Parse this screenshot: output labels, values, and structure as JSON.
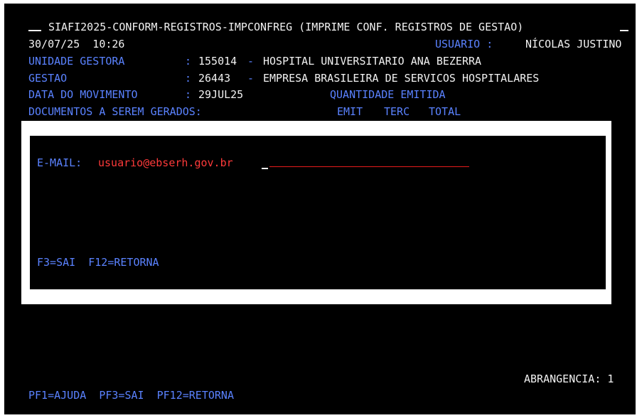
{
  "header": {
    "title": "SIAFI2025-CONFORM-REGISTROS-IMPCONFREG (IMPRIME CONF. REGISTROS DE GESTAO)",
    "date_time": "30/07/25  10:26",
    "user_label": "USUARIO :",
    "user_name": "NÍCOLAS JUSTINO"
  },
  "fields": {
    "unidade_label": "UNIDADE GESTORA",
    "unidade_colon": ":",
    "unidade_code": "155014",
    "unidade_dash": "-",
    "unidade_name": "HOSPITAL UNIVERSITARIO ANA BEZERRA",
    "gestao_label": "GESTAO",
    "gestao_colon": ":",
    "gestao_code": "26443",
    "gestao_dash": "-",
    "gestao_name": "EMPRESA BRASILEIRA DE SERVICOS HOSPITALARES",
    "data_label": "DATA DO MOVIMENTO",
    "data_colon": ":",
    "data_value": "29JUL25",
    "quantidade_label": "QUANTIDADE EMITIDA",
    "documentos_label": "DOCUMENTOS A SEREM GERADOS:",
    "col_emit": "EMIT",
    "col_terc": "TERC",
    "col_total": "TOTAL"
  },
  "dialog": {
    "email_label": "E-MAIL:",
    "email_value": "usuario@ebserh.gov.br",
    "keys": "F3=SAI  F12=RETORNA"
  },
  "footer": {
    "abrangencia": "ABRANGENCIA: 1",
    "pf_keys": "PF1=AJUDA  PF3=SAI  PF12=RETORNA"
  }
}
